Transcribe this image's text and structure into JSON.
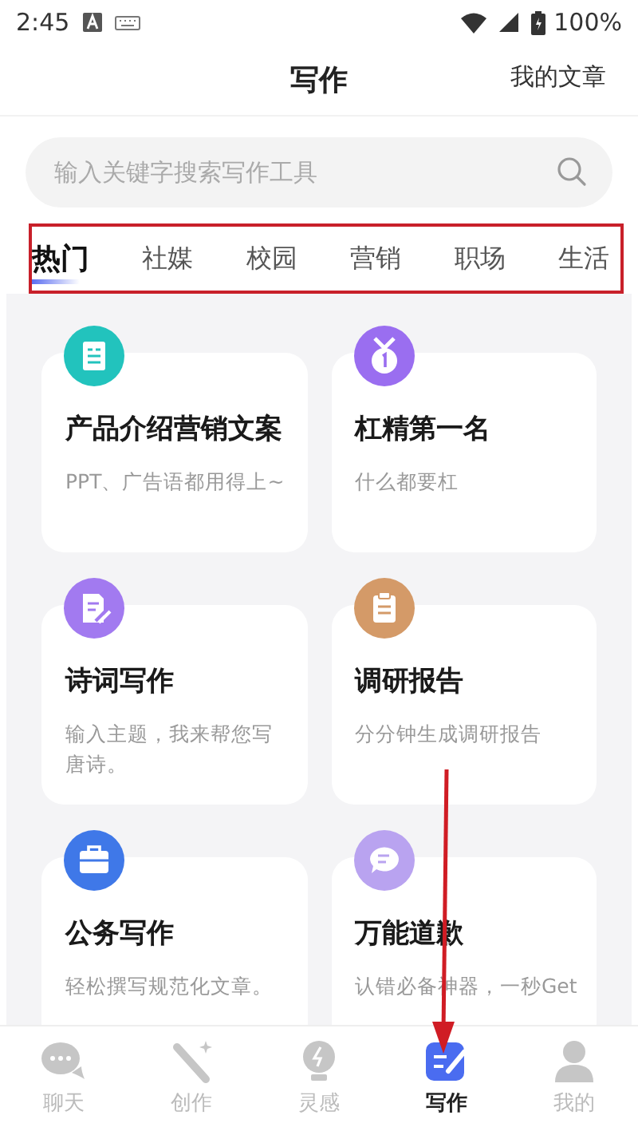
{
  "status_bar": {
    "time": "2:45",
    "battery": "100%"
  },
  "header": {
    "title": "写作",
    "action": "我的文章"
  },
  "search": {
    "placeholder": "输入关键字搜索写作工具"
  },
  "tabs": [
    {
      "label": "热门",
      "selected": true
    },
    {
      "label": "社媒",
      "selected": false
    },
    {
      "label": "校园",
      "selected": false
    },
    {
      "label": "营销",
      "selected": false
    },
    {
      "label": "职场",
      "selected": false
    },
    {
      "label": "生活",
      "selected": false
    }
  ],
  "cards": [
    {
      "kind": "document",
      "color": "#22c3bd",
      "title": "产品介绍营销文案",
      "description": "PPT、广告语都用得上~"
    },
    {
      "kind": "medal",
      "color": "#9a6ef0",
      "title": "杠精第一名",
      "description": "什么都要杠"
    },
    {
      "kind": "pen",
      "color": "#a27af0",
      "title": "诗词写作",
      "description": "输入主题，我来帮您写唐诗。"
    },
    {
      "kind": "clipboard",
      "color": "#d49a68",
      "title": "调研报告",
      "description": "分分钟生成调研报告"
    },
    {
      "kind": "briefcase",
      "color": "#3f78e8",
      "title": "公务写作",
      "description": "轻松撰写规范化文章。"
    },
    {
      "kind": "chat",
      "color": "#b9a3f0",
      "title": "万能道歉",
      "description": "认错必备神器，一秒Get"
    }
  ],
  "bottom_nav": [
    {
      "kind": "chat",
      "label": "聊天",
      "selected": false
    },
    {
      "kind": "wand",
      "label": "创作",
      "selected": false
    },
    {
      "kind": "bulb",
      "label": "灵感",
      "selected": false
    },
    {
      "kind": "write",
      "label": "写作",
      "selected": true
    },
    {
      "kind": "person",
      "label": "我的",
      "selected": false
    }
  ]
}
